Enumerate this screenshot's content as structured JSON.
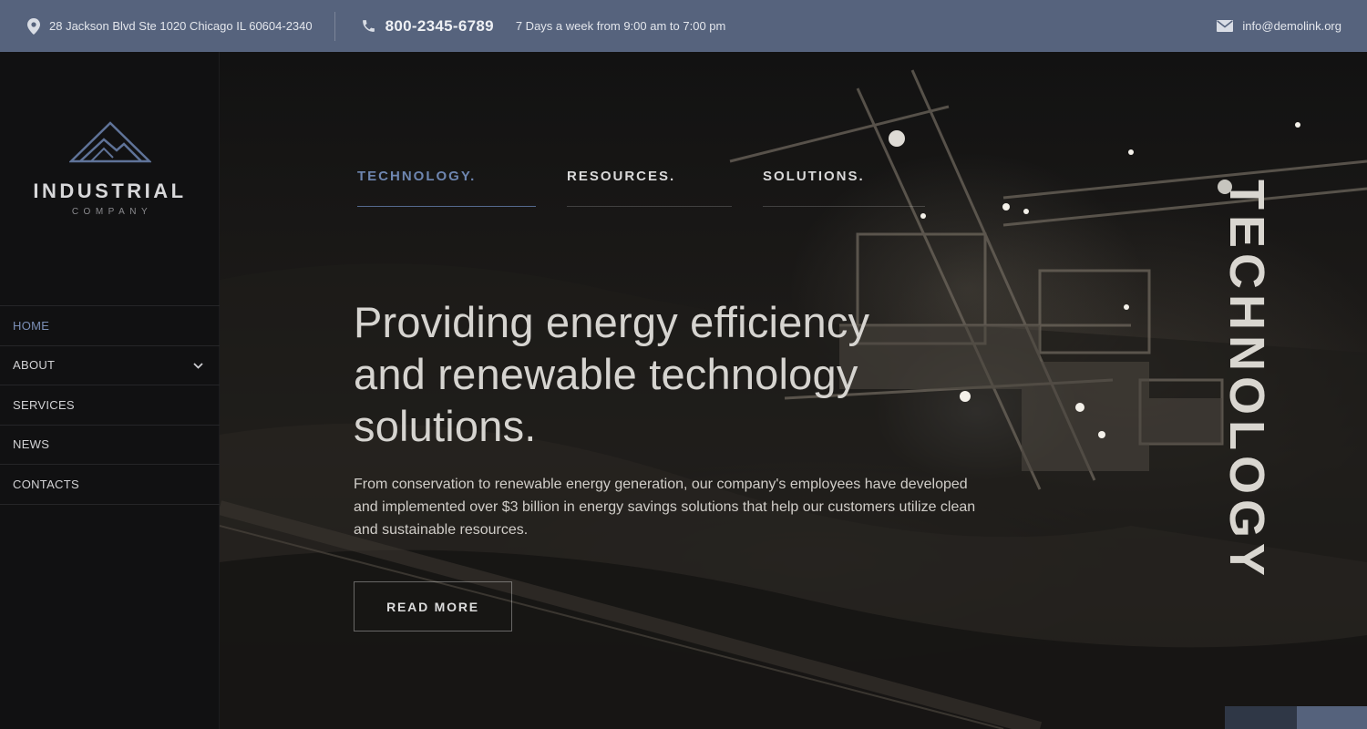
{
  "topbar": {
    "address": "28 Jackson Blvd Ste 1020 Chicago IL 60604-2340",
    "phone": "800-2345-6789",
    "hours": "7 Days a week from 9:00 am to 7:00 pm",
    "email": "info@demolink.org",
    "icons": [
      "location-pin-icon",
      "phone-icon",
      "envelope-icon"
    ]
  },
  "logo": {
    "title": "INDUSTRIAL",
    "subtitle": "COMPANY"
  },
  "nav": {
    "items": [
      {
        "label": "HOME",
        "active": true
      },
      {
        "label": "ABOUT",
        "has_submenu": true
      },
      {
        "label": "SERVICES"
      },
      {
        "label": "NEWS"
      },
      {
        "label": "CONTACTS"
      }
    ]
  },
  "hero": {
    "tabs": [
      {
        "label": "TECHNOLOGY.",
        "active": true
      },
      {
        "label": "RESOURCES."
      },
      {
        "label": "SOLUTIONS."
      }
    ],
    "headline": "Providing energy efficiency and renewable technology solutions.",
    "description": "From conservation to renewable energy generation, our company's employees have developed and implemented over $3 billion in energy savings solutions that help our customers utilize clean and sustainable resources.",
    "button_label": "READ MORE",
    "vertical_word": "TECHNOLOGY"
  },
  "colors": {
    "topbar_bg": "#56637d",
    "accent": "#6e86b0",
    "sidebar_bg": "#111112"
  }
}
